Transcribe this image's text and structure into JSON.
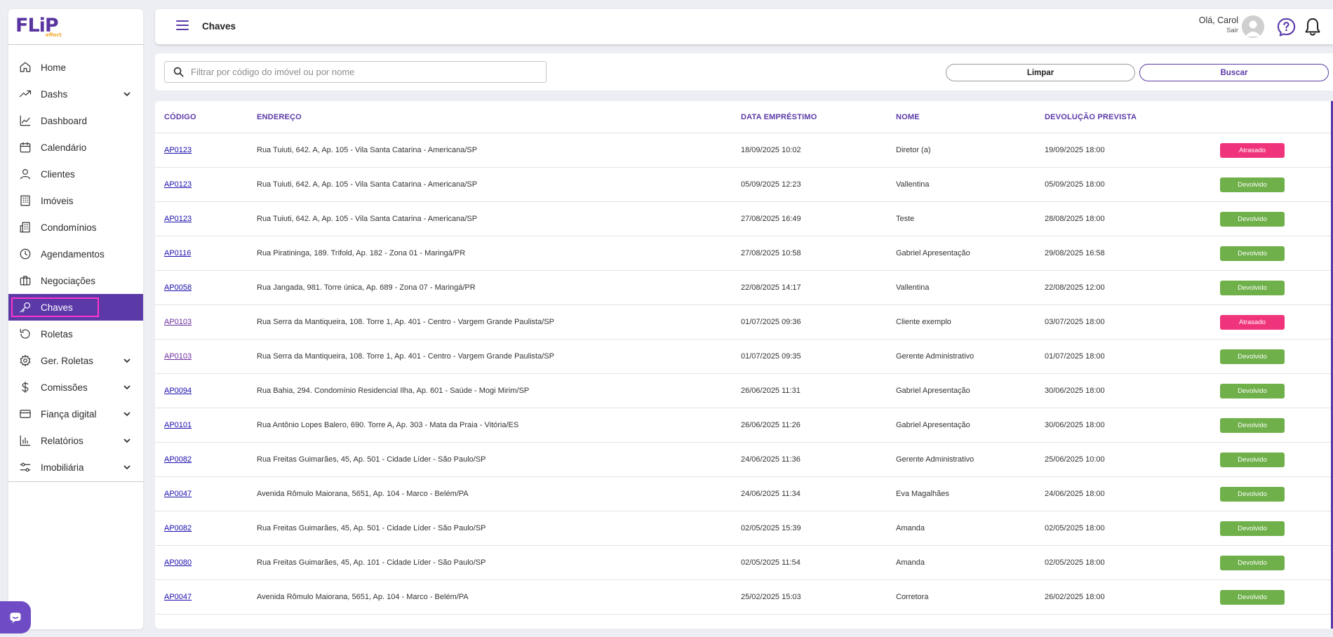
{
  "app": {
    "logo": "FLiP",
    "logo_sub": "effect"
  },
  "sidebar": {
    "items": [
      {
        "label": "Home",
        "icon": "home-icon",
        "expandable": false,
        "active": false
      },
      {
        "label": "Dashs",
        "icon": "trending-up-icon",
        "expandable": true,
        "active": false
      },
      {
        "label": "Dashboard",
        "icon": "line-chart-icon",
        "expandable": false,
        "active": false
      },
      {
        "label": "Calendário",
        "icon": "calendar-icon",
        "expandable": false,
        "active": false
      },
      {
        "label": "Clientes",
        "icon": "user-icon",
        "expandable": false,
        "active": false
      },
      {
        "label": "Imóveis",
        "icon": "building-icon",
        "expandable": false,
        "active": false
      },
      {
        "label": "Condomínios",
        "icon": "buildings-icon",
        "expandable": false,
        "active": false
      },
      {
        "label": "Agendamentos",
        "icon": "clock-icon",
        "expandable": false,
        "active": false
      },
      {
        "label": "Negociações",
        "icon": "briefcase-icon",
        "expandable": false,
        "active": false
      },
      {
        "label": "Chaves",
        "icon": "key-icon",
        "expandable": false,
        "active": true
      },
      {
        "label": "Roletas",
        "icon": "rotate-icon",
        "expandable": false,
        "active": false
      },
      {
        "label": "Ger. Roletas",
        "icon": "gear-icon",
        "expandable": true,
        "active": false
      },
      {
        "label": "Comissões",
        "icon": "dollar-icon",
        "expandable": true,
        "active": false
      },
      {
        "label": "Fiança digital",
        "icon": "credit-card-icon",
        "expandable": true,
        "active": false
      },
      {
        "label": "Relatórios",
        "icon": "bar-chart-icon",
        "expandable": true,
        "active": false
      },
      {
        "label": "Imobiliária",
        "icon": "settings-sliders-icon",
        "expandable": true,
        "active": false
      }
    ]
  },
  "header": {
    "title": "Chaves",
    "greeting": "Olá, Carol",
    "logout": "Sair"
  },
  "filter": {
    "placeholder": "Filtrar por código do imóvel ou por nome",
    "value": "",
    "clear_label": "Limpar",
    "search_label": "Buscar"
  },
  "table": {
    "columns": [
      "CÓDIGO",
      "ENDEREÇO",
      "DATA EMPRÉSTIMO",
      "NOME",
      "DEVOLUÇÃO PREVISTA"
    ],
    "rows": [
      {
        "code": "AP0123",
        "address": "Rua Tuiuti, 642. A, Ap. 105 - Vila Santa Catarina - Americana/SP",
        "loan_date": "18/09/2025 10:02",
        "name": "Diretor (a)",
        "return_date": "19/09/2025 18:00",
        "status": "Atrasado",
        "visited": false
      },
      {
        "code": "AP0123",
        "address": "Rua Tuiuti, 642. A, Ap. 105 - Vila Santa Catarina - Americana/SP",
        "loan_date": "05/09/2025 12:23",
        "name": "Vallentina",
        "return_date": "05/09/2025 18:00",
        "status": "Devolvido",
        "visited": false
      },
      {
        "code": "AP0123",
        "address": "Rua Tuiuti, 642. A, Ap. 105 - Vila Santa Catarina - Americana/SP",
        "loan_date": "27/08/2025 16:49",
        "name": "Teste",
        "return_date": "28/08/2025 18:00",
        "status": "Devolvido",
        "visited": false
      },
      {
        "code": "AP0116",
        "address": "Rua Piratininga, 189. Trifold, Ap. 182 - Zona 01 - Maringá/PR",
        "loan_date": "27/08/2025 10:58",
        "name": "Gabriel Apresentação",
        "return_date": "29/08/2025 16:58",
        "status": "Devolvido",
        "visited": false
      },
      {
        "code": "AP0058",
        "address": "Rua Jangada, 981. Torre única, Ap. 689 - Zona 07 - Maringá/PR",
        "loan_date": "22/08/2025 14:17",
        "name": "Vallentina",
        "return_date": "22/08/2025 12:00",
        "status": "Devolvido",
        "visited": false
      },
      {
        "code": "AP0103",
        "address": "Rua Serra da Mantiqueira, 108. Torre 1, Ap. 401 - Centro - Vargem Grande Paulista/SP",
        "loan_date": "01/07/2025 09:36",
        "name": "Cliente exemplo",
        "return_date": "03/07/2025 18:00",
        "status": "Atrasado",
        "visited": true
      },
      {
        "code": "AP0103",
        "address": "Rua Serra da Mantiqueira, 108. Torre 1, Ap. 401 - Centro - Vargem Grande Paulista/SP",
        "loan_date": "01/07/2025 09:35",
        "name": "Gerente Administrativo",
        "return_date": "01/07/2025 18:00",
        "status": "Devolvido",
        "visited": true
      },
      {
        "code": "AP0094",
        "address": "Rua Bahia, 294. Condomínio Residencial Ilha, Ap. 601 - Saúde - Mogi Mirim/SP",
        "loan_date": "26/06/2025 11:31",
        "name": "Gabriel Apresentação",
        "return_date": "30/06/2025 18:00",
        "status": "Devolvido",
        "visited": false
      },
      {
        "code": "AP0101",
        "address": "Rua Antônio Lopes Balero, 690. Torre A, Ap. 303 - Mata da Praia - Vitória/ES",
        "loan_date": "26/06/2025 11:26",
        "name": "Gabriel Apresentação",
        "return_date": "30/06/2025 18:00",
        "status": "Devolvido",
        "visited": false
      },
      {
        "code": "AP0082",
        "address": "Rua Freitas Guimarães, 45, Ap. 501 - Cidade Líder - São Paulo/SP",
        "loan_date": "24/06/2025 11:36",
        "name": "Gerente Administrativo",
        "return_date": "25/06/2025 10:00",
        "status": "Devolvido",
        "visited": false
      },
      {
        "code": "AP0047",
        "address": "Avenida Rômulo Maiorana, 5651, Ap. 104 - Marco - Belém/PA",
        "loan_date": "24/06/2025 11:34",
        "name": "Eva Magalhães",
        "return_date": "24/06/2025 18:00",
        "status": "Devolvido",
        "visited": false
      },
      {
        "code": "AP0082",
        "address": "Rua Freitas Guimarães, 45, Ap. 501 - Cidade Líder - São Paulo/SP",
        "loan_date": "02/05/2025 15:39",
        "name": "Amanda",
        "return_date": "02/05/2025 18:00",
        "status": "Devolvido",
        "visited": false
      },
      {
        "code": "AP0080",
        "address": "Rua Freitas Guimarães, 45, Ap. 101 - Cidade Líder - São Paulo/SP",
        "loan_date": "02/05/2025 11:54",
        "name": "Amanda",
        "return_date": "02/05/2025 18:00",
        "status": "Devolvido",
        "visited": false
      },
      {
        "code": "AP0047",
        "address": "Avenida Rômulo Maiorana, 5651, Ap. 104 - Marco - Belém/PA",
        "loan_date": "25/02/2025 15:03",
        "name": "Corretora",
        "return_date": "26/02/2025 18:00",
        "status": "Devolvido",
        "visited": false
      }
    ]
  },
  "colors": {
    "brand": "#5b3aa8",
    "late": "#f0347c",
    "returned": "#6fb04a",
    "highlight": "#ff33cc"
  }
}
